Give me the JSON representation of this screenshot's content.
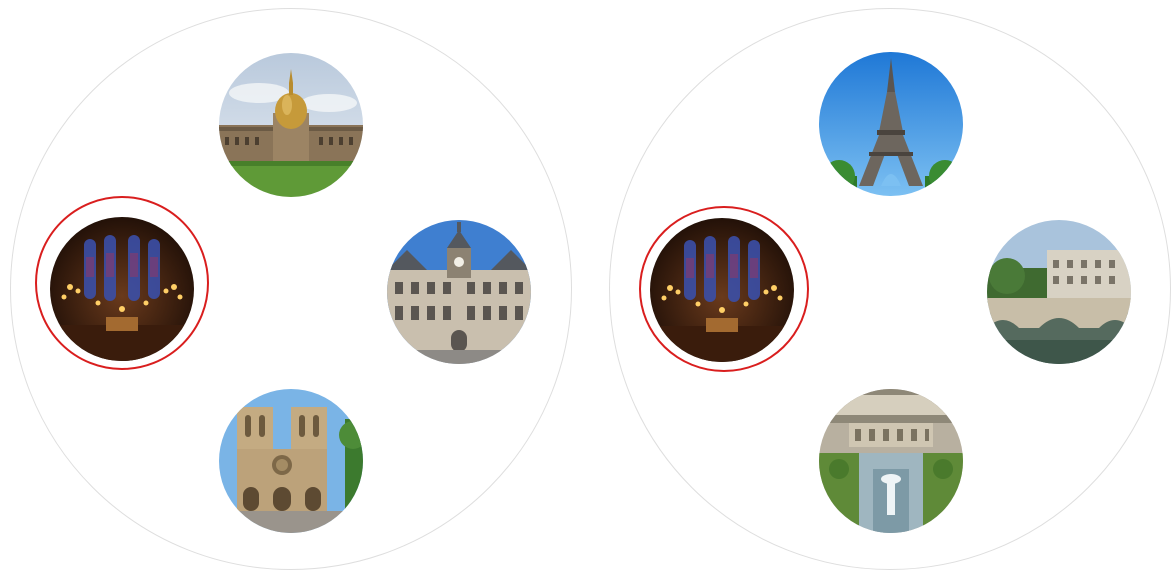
{
  "groups": [
    {
      "items": [
        {
          "icon": "dome-church-photo-icon",
          "selected": false
        },
        {
          "icon": "gothic-chapel-interior-photo-icon",
          "selected": true
        },
        {
          "icon": "city-hall-photo-icon",
          "selected": false
        },
        {
          "icon": "cathedral-facade-photo-icon",
          "selected": false
        }
      ]
    },
    {
      "items": [
        {
          "icon": "iron-tower-photo-icon",
          "selected": false
        },
        {
          "icon": "gothic-chapel-interior-photo-icon",
          "selected": true
        },
        {
          "icon": "stone-bridge-photo-icon",
          "selected": false
        },
        {
          "icon": "palace-gardens-fountain-photo-icon",
          "selected": false
        }
      ]
    }
  ],
  "colors": {
    "selection": "#d91e1e",
    "ring": "#dedede"
  }
}
